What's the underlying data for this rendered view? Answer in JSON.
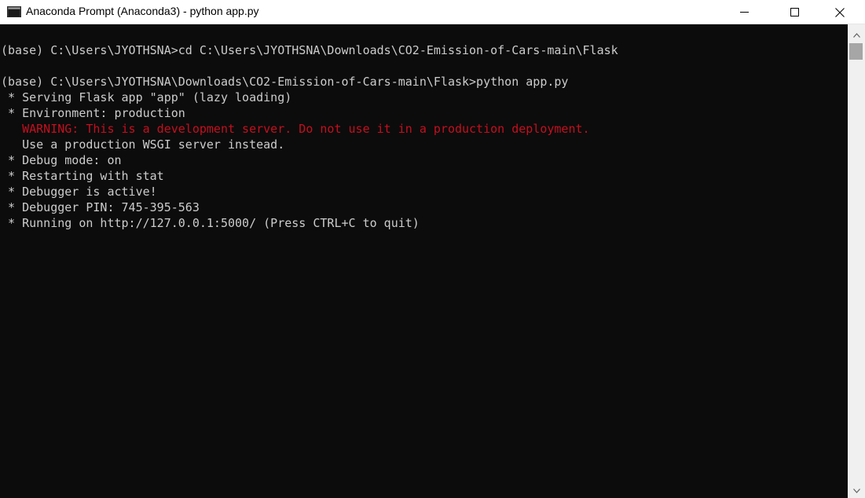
{
  "window": {
    "title": "Anaconda Prompt (Anaconda3) - python  app.py"
  },
  "icons": {
    "app": "console-window-icon",
    "minimize": "minimize-icon",
    "maximize": "maximize-icon",
    "close": "close-icon",
    "scroll_up": "chevron-up-icon",
    "scroll_down": "chevron-down-icon"
  },
  "colors": {
    "background": "#0c0c0c",
    "text": "#cccccc",
    "warning": "#c50f1f"
  },
  "terminal": {
    "lines": [
      "(base) C:\\Users\\JYOTHSNA>cd C:\\Users\\JYOTHSNA\\Downloads\\CO2-Emission-of-Cars-main\\Flask",
      "",
      "(base) C:\\Users\\JYOTHSNA\\Downloads\\CO2-Emission-of-Cars-main\\Flask>python app.py",
      " * Serving Flask app \"app\" (lazy loading)",
      " * Environment: production",
      "   WARNING: This is a development server. Do not use it in a production deployment.",
      "   Use a production WSGI server instead.",
      " * Debug mode: on",
      " * Restarting with stat",
      " * Debugger is active!",
      " * Debugger PIN: 745-395-563",
      " * Running on http://127.0.0.1:5000/ (Press CTRL+C to quit)"
    ]
  }
}
